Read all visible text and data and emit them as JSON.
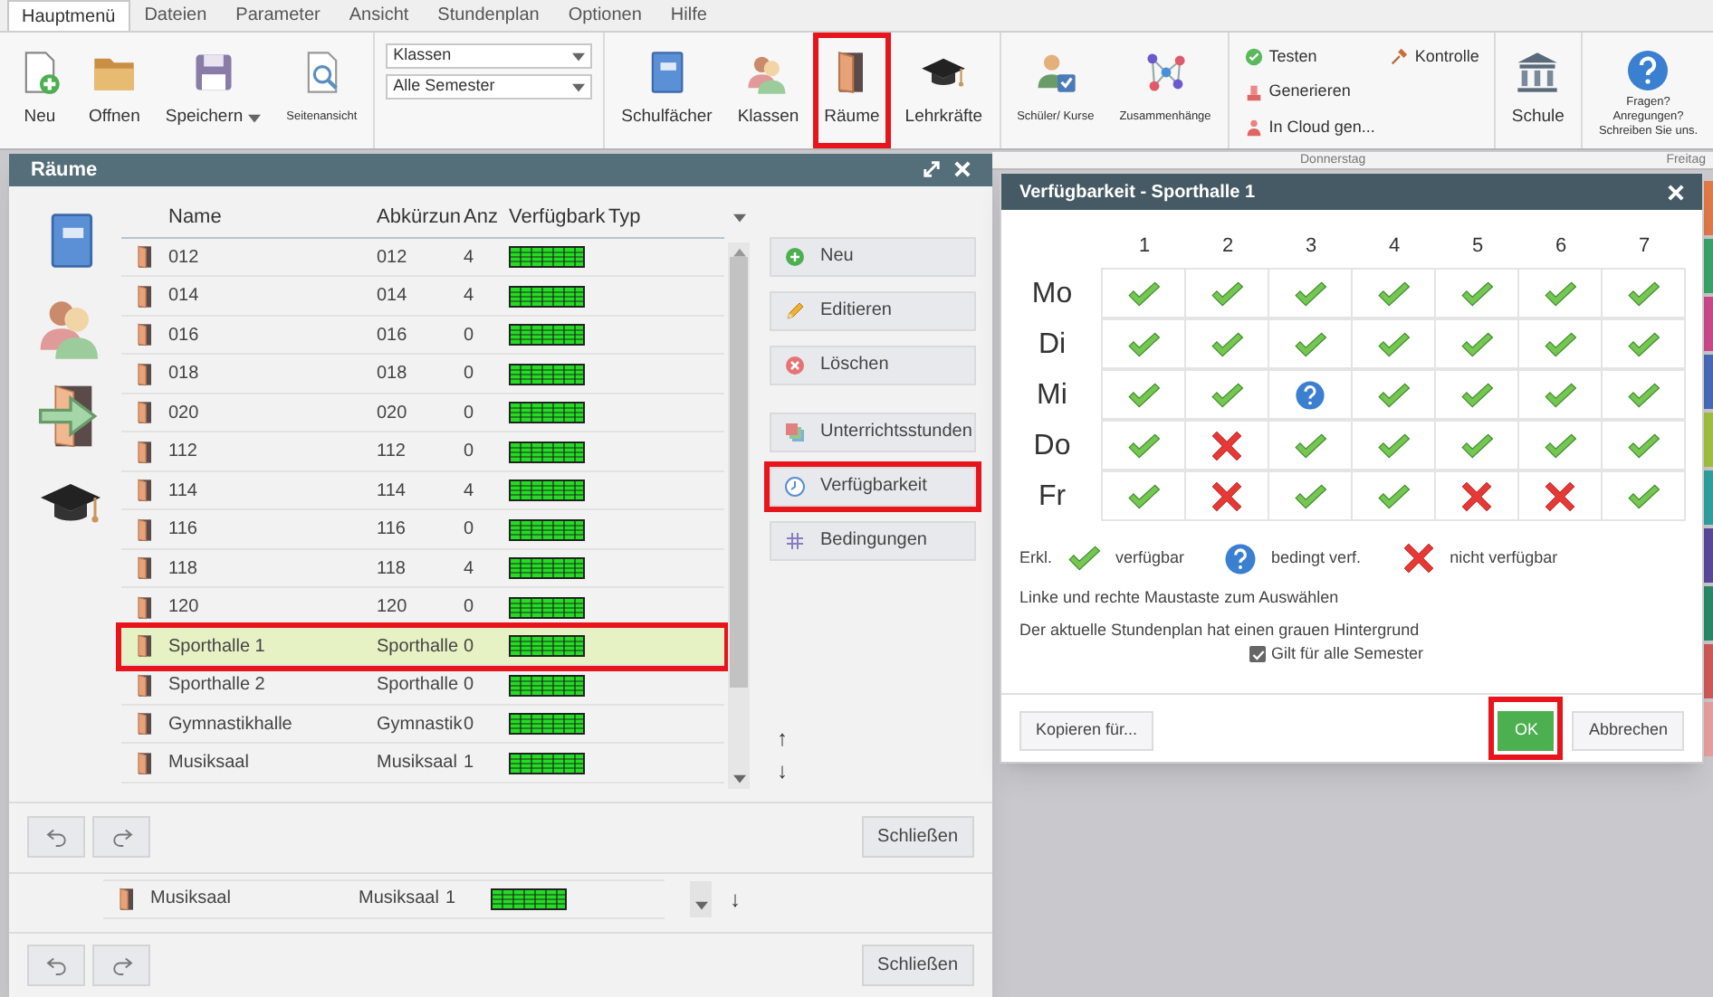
{
  "menu_tabs": [
    {
      "label": "Hauptmenü",
      "selected": true
    },
    {
      "label": "Dateien",
      "selected": false
    },
    {
      "label": "Parameter",
      "selected": false
    },
    {
      "label": "Ansicht",
      "selected": false
    },
    {
      "label": "Stundenplan",
      "selected": false
    },
    {
      "label": "Optionen",
      "selected": false
    },
    {
      "label": "Hilfe",
      "selected": false
    }
  ],
  "ribbon": [
    {
      "kind": "buttons",
      "items": [
        {
          "label": "Neu",
          "kind": "large",
          "highlighted": false
        },
        {
          "label": "Offnen",
          "kind": "large",
          "highlighted": false
        },
        {
          "label": "Speichern",
          "kind": "large",
          "dropdown": true,
          "highlighted": false
        },
        {
          "label": "Seitenansicht",
          "kind": "compact",
          "highlighted": false
        }
      ]
    },
    {
      "kind": "selects",
      "items": [
        {
          "value": "Klassen"
        },
        {
          "value": "Alle Semester"
        }
      ]
    },
    {
      "kind": "buttons",
      "items": [
        {
          "label": "Schulfächer",
          "kind": "large",
          "highlighted": false
        },
        {
          "label": "Klassen",
          "kind": "large",
          "highlighted": false
        },
        {
          "label": "Räume",
          "kind": "large",
          "highlighted": true
        },
        {
          "label": "Lehrkräfte",
          "kind": "large",
          "highlighted": false
        }
      ]
    },
    {
      "kind": "buttons",
      "items": [
        {
          "label": "Schüler/ Kurse",
          "kind": "compact",
          "highlighted": false
        },
        {
          "label": "Zusammenhänge",
          "kind": "compact",
          "highlighted": false
        }
      ]
    },
    {
      "kind": "list",
      "items": [
        {
          "label": "Testen"
        },
        {
          "label": "Generieren"
        },
        {
          "label": "In Cloud gen..."
        },
        {
          "label": "Kontrolle"
        }
      ]
    },
    {
      "kind": "buttons",
      "items": [
        {
          "label": "Schule",
          "kind": "large",
          "highlighted": false
        }
      ]
    },
    {
      "kind": "buttons",
      "items": [
        {
          "label": "Fragen?\nAnregungen?\nSchreiben Sie uns.",
          "kind": "compact",
          "highlighted": false
        }
      ]
    }
  ],
  "background_timetable": {
    "day_headers": [
      "Donnerstag",
      "Freitag"
    ]
  },
  "rooms_dialog": {
    "title": "Räume",
    "columns": [
      "Name",
      "Abkürzun",
      "Anz",
      "Verfügbark",
      "Typ"
    ],
    "rows": [
      {
        "name": "012",
        "abbr": "012",
        "count": "4",
        "selected": false,
        "highlighted": false
      },
      {
        "name": "014",
        "abbr": "014",
        "count": "4",
        "selected": false,
        "highlighted": false
      },
      {
        "name": "016",
        "abbr": "016",
        "count": "0",
        "selected": false,
        "highlighted": false
      },
      {
        "name": "018",
        "abbr": "018",
        "count": "0",
        "selected": false,
        "highlighted": false
      },
      {
        "name": "020",
        "abbr": "020",
        "count": "0",
        "selected": false,
        "highlighted": false
      },
      {
        "name": "112",
        "abbr": "112",
        "count": "0",
        "selected": false,
        "highlighted": false
      },
      {
        "name": "114",
        "abbr": "114",
        "count": "4",
        "selected": false,
        "highlighted": false
      },
      {
        "name": "116",
        "abbr": "116",
        "count": "0",
        "selected": false,
        "highlighted": false
      },
      {
        "name": "118",
        "abbr": "118",
        "count": "4",
        "selected": false,
        "highlighted": false
      },
      {
        "name": "120",
        "abbr": "120",
        "count": "0",
        "selected": false,
        "highlighted": false
      },
      {
        "name": "Sporthalle 1",
        "abbr": "Sporthalle",
        "count": "0",
        "selected": true,
        "highlighted": true
      },
      {
        "name": "Sporthalle 2",
        "abbr": "Sporthalle",
        "count": "0",
        "selected": false,
        "highlighted": false
      },
      {
        "name": "Gymnastikhalle",
        "abbr": "Gymnastik",
        "count": "0",
        "selected": false,
        "highlighted": false
      },
      {
        "name": "Musiksaal",
        "abbr": "Musiksaal",
        "count": "1",
        "selected": false,
        "highlighted": false
      }
    ],
    "actions": [
      {
        "label": "Neu",
        "highlighted": false
      },
      {
        "label": "Editieren",
        "highlighted": false
      },
      {
        "label": "Löschen",
        "highlighted": false
      },
      {
        "label": "Unterrichtsstunden",
        "highlighted": false
      },
      {
        "label": "Verfügbarkeit",
        "highlighted": true
      },
      {
        "label": "Bedingungen",
        "highlighted": false
      }
    ],
    "move_up": "↑",
    "move_down": "↓",
    "close_button": "Schließen",
    "ghost": {
      "row": {
        "name": "Musiksaal",
        "abbr": "Musiksaal",
        "count": "1"
      },
      "move_down": "↓",
      "close_button": "Schließen"
    }
  },
  "availability_dialog": {
    "title": "Verfügbarkeit - Sporthalle 1",
    "periods": [
      "1",
      "2",
      "3",
      "4",
      "5",
      "6",
      "7"
    ],
    "days": [
      {
        "day": "Mo",
        "cells": [
          {
            "kind": "available"
          },
          {
            "kind": "available"
          },
          {
            "kind": "available"
          },
          {
            "kind": "available"
          },
          {
            "kind": "available"
          },
          {
            "kind": "available"
          },
          {
            "kind": "available"
          }
        ]
      },
      {
        "day": "Di",
        "cells": [
          {
            "kind": "available"
          },
          {
            "kind": "available"
          },
          {
            "kind": "available"
          },
          {
            "kind": "available"
          },
          {
            "kind": "available"
          },
          {
            "kind": "available"
          },
          {
            "kind": "available"
          }
        ]
      },
      {
        "day": "Mi",
        "cells": [
          {
            "kind": "available"
          },
          {
            "kind": "available"
          },
          {
            "kind": "conditional"
          },
          {
            "kind": "available"
          },
          {
            "kind": "available"
          },
          {
            "kind": "available"
          },
          {
            "kind": "available"
          }
        ]
      },
      {
        "day": "Do",
        "cells": [
          {
            "kind": "available"
          },
          {
            "kind": "unavailable"
          },
          {
            "kind": "available"
          },
          {
            "kind": "available"
          },
          {
            "kind": "available"
          },
          {
            "kind": "available"
          },
          {
            "kind": "available"
          }
        ]
      },
      {
        "day": "Fr",
        "cells": [
          {
            "kind": "available"
          },
          {
            "kind": "unavailable"
          },
          {
            "kind": "available"
          },
          {
            "kind": "available"
          },
          {
            "kind": "unavailable"
          },
          {
            "kind": "unavailable"
          },
          {
            "kind": "available"
          }
        ]
      }
    ],
    "legend_label": "Erkl.",
    "legend": [
      {
        "kind": "available",
        "label": "verfügbar"
      },
      {
        "kind": "conditional",
        "label": "bedingt verf."
      },
      {
        "kind": "unavailable",
        "label": "nicht verfügbar"
      }
    ],
    "notes": [
      "Linke und rechte Maustaste zum Auswählen",
      "Der aktuelle Stundenplan hat einen grauen Hintergrund"
    ],
    "all_semesters": {
      "label": "Gilt für alle Semester",
      "checked": true
    },
    "buttons": [
      {
        "label": "Kopieren für...",
        "kind": "secondary",
        "highlighted": false
      },
      {
        "label": "OK",
        "kind": "primary",
        "highlighted": true
      },
      {
        "label": "Abbrechen",
        "kind": "secondary",
        "highlighted": false
      }
    ]
  }
}
